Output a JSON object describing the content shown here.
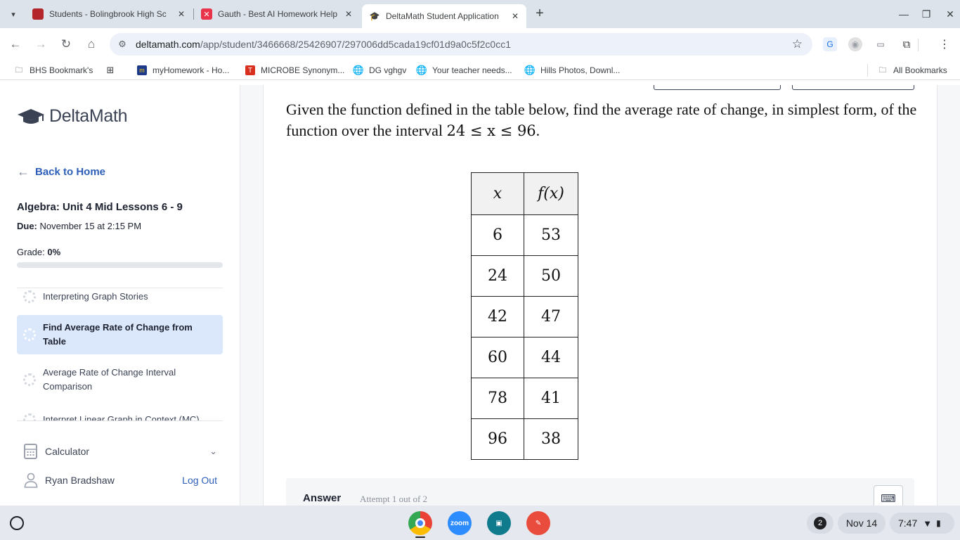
{
  "tabs": [
    {
      "title": "Students - Bolingbrook High Sc",
      "icon": "school-flag-icon",
      "color": "#b3262b"
    },
    {
      "title": "Gauth - Best AI Homework Help",
      "icon": "gauth-icon",
      "color": "#e8334a"
    },
    {
      "title": "DeltaMath Student Application",
      "icon": "deltamath-icon",
      "color": "#3a4254",
      "active": true
    }
  ],
  "address": {
    "host": "deltamath.com",
    "path": "/app/student/3466668/25426907/297006dd5cada19cf01d9a0c5f2c0cc1"
  },
  "bookmarks": [
    {
      "label": "BHS Bookmark's",
      "icon": "folder-icon"
    },
    {
      "label": "",
      "icon": "apps-grid-icon"
    },
    {
      "label": "myHomework - Ho...",
      "icon": "myhomework-icon"
    },
    {
      "label": "MICROBE Synonym...",
      "icon": "thesaurus-icon"
    },
    {
      "label": "DG vghgv",
      "icon": "globe-icon"
    },
    {
      "label": "Your teacher needs...",
      "icon": "globe-icon"
    },
    {
      "label": "Hills Photos, Downl...",
      "icon": "globe-icon"
    },
    {
      "label": "All Bookmarks",
      "icon": "folder-icon"
    }
  ],
  "sidebar": {
    "logo_text": "DeltaMath",
    "back_label": "Back to Home",
    "assignment_title": "Algebra: Unit 4 Mid Lessons 6 - 9",
    "due_label": "Due:",
    "due_value": "November 15 at 2:15 PM",
    "grade_label": "Grade:",
    "grade_value": "0%",
    "grade_fraction": 0,
    "problems": [
      {
        "label": "Interpreting Graph Stories"
      },
      {
        "label": "Find Average Rate of Change from Table",
        "active": true
      },
      {
        "label": "Average Rate of Change Interval Comparison"
      },
      {
        "label": "Interpret Linear Graph in Context (MC)"
      }
    ],
    "calculator_label": "Calculator",
    "user_name": "Ryan Bradshaw",
    "logout_label": "Log Out"
  },
  "problem": {
    "text_before": "Given the function defined in the table below, find the average rate of change, in simplest form, of the function over the interval ",
    "interval": "24 ≤ x ≤ 96",
    "text_after": ".",
    "table_headers": [
      "x",
      "f(x)"
    ],
    "table_rows": [
      [
        "6",
        "53"
      ],
      [
        "24",
        "50"
      ],
      [
        "42",
        "47"
      ],
      [
        "60",
        "44"
      ],
      [
        "78",
        "41"
      ],
      [
        "96",
        "38"
      ]
    ]
  },
  "answer": {
    "label": "Answer",
    "attempt": "Attempt 1 out of 2"
  },
  "shelf": {
    "notifications": "2",
    "date": "Nov 14",
    "time": "7:47"
  }
}
